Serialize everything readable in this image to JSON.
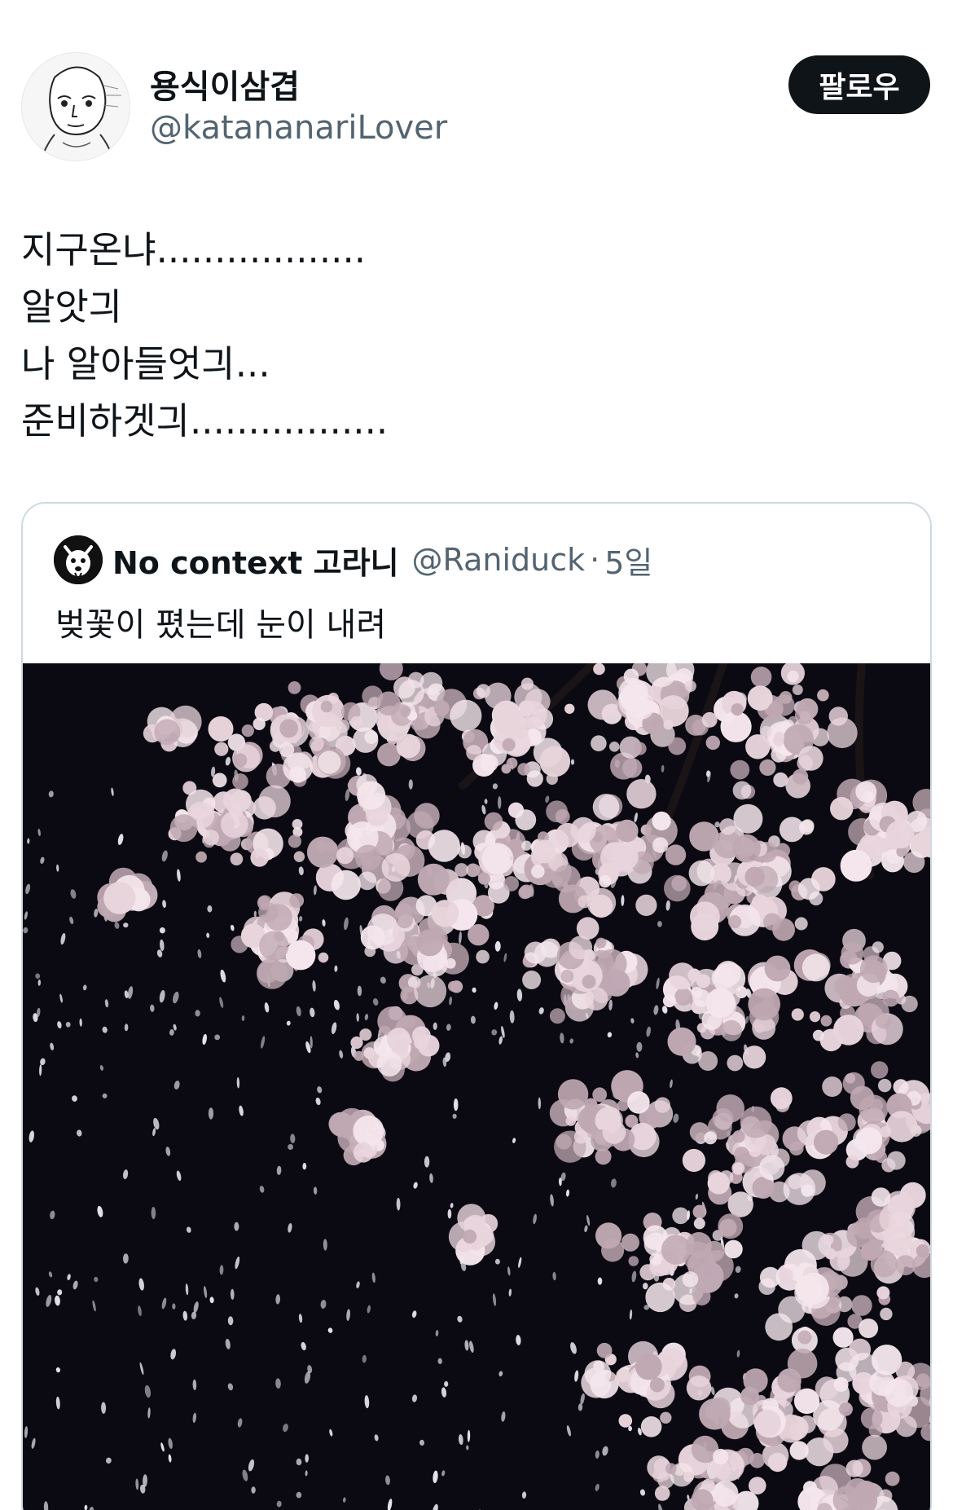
{
  "author": {
    "display_name": "용식이삼겹",
    "handle": "@katananariLover",
    "avatar_icon": "sketch-avatar-icon"
  },
  "follow_button": {
    "label": "팔로우"
  },
  "tweet": {
    "lines": [
      "지구온냐..................",
      "알앗긔",
      "나 알아들엇긔...",
      "준비하겟긔................."
    ]
  },
  "quote": {
    "display_name": "No context 고라니",
    "handle": "@Raniduck",
    "separator": "·",
    "time": "5일",
    "text": "벚꽃이 폈는데 눈이 내려",
    "avatar_icon": "deer-avatar-icon",
    "media_description_icon": "cherry-blossom-night-photo"
  },
  "colors": {
    "text_primary": "#0f1419",
    "text_secondary": "#536471",
    "border": "#cfd9de",
    "follow_bg": "#0f1419",
    "media_bg": "#0b0a12",
    "blossom": "#e8d4dc"
  }
}
